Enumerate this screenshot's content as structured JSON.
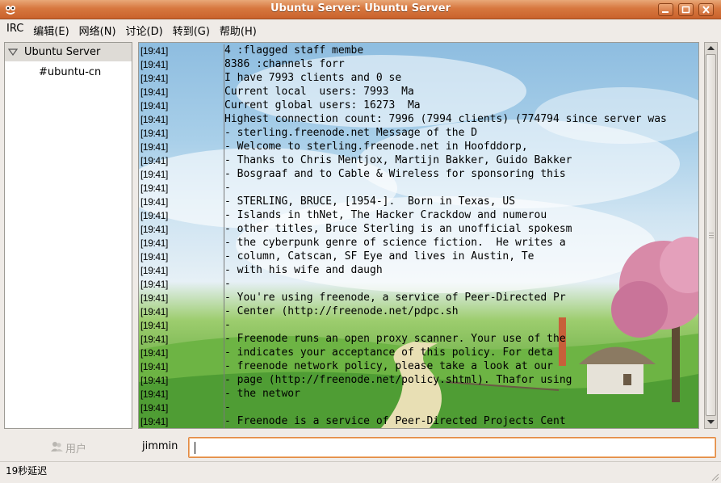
{
  "window": {
    "title": "Ubuntu Server: Ubuntu Server",
    "minimize_icon": "minimize-icon",
    "maximize_icon": "maximize-icon",
    "close_icon": "close-icon"
  },
  "menu": [
    {
      "label": "IRC"
    },
    {
      "label": "编辑(E)"
    },
    {
      "label": "网络(N)"
    },
    {
      "label": "讨论(D)"
    },
    {
      "label": "转到(G)"
    },
    {
      "label": "帮助(H)"
    }
  ],
  "sidebar": {
    "server": "Ubuntu Server",
    "channels": [
      "#ubuntu-cn"
    ]
  },
  "chat": {
    "lines": [
      {
        "ts": "[19:41]",
        "text": "4 :flagged staff membe"
      },
      {
        "ts": "[19:41]",
        "text": "8386 :channels forr"
      },
      {
        "ts": "[19:41]",
        "text": "I have 7993 clients and 0 se"
      },
      {
        "ts": "[19:41]",
        "text": "Current local  users: 7993  Ma"
      },
      {
        "ts": "[19:41]",
        "text": "Current global users: 16273  Ma"
      },
      {
        "ts": "[19:41]",
        "text": "Highest connection count: 7996 (7994 clients) (774794 since server was"
      },
      {
        "ts": "[19:41]",
        "text": "- sterling.freenode.net Message of the D"
      },
      {
        "ts": "[19:41]",
        "text": "- Welcome to sterling.freenode.net in Hoofddorp,"
      },
      {
        "ts": "[19:41]",
        "text": "- Thanks to Chris Mentjox, Martijn Bakker, Guido Bakker"
      },
      {
        "ts": "[19:41]",
        "text": "- Bosgraaf and to Cable & Wireless for sponsoring this"
      },
      {
        "ts": "[19:41]",
        "text": "-"
      },
      {
        "ts": "[19:41]",
        "text": "- STERLING, BRUCE, [1954-].  Born in Texas, US"
      },
      {
        "ts": "[19:41]",
        "text": "- Islands in thNet, The Hacker Crackdow and numerou"
      },
      {
        "ts": "[19:41]",
        "text": "- other titles, Bruce Sterling is an unofficial spokesm"
      },
      {
        "ts": "[19:41]",
        "text": "- the cyberpunk genre of science fiction.  He writes a"
      },
      {
        "ts": "[19:41]",
        "text": "- column, Catscan, SF Eye and lives in Austin, Te"
      },
      {
        "ts": "[19:41]",
        "text": "- with his wife and daugh"
      },
      {
        "ts": "[19:41]",
        "text": "-"
      },
      {
        "ts": "[19:41]",
        "text": "- You're using freenode, a service of Peer-Directed Pr"
      },
      {
        "ts": "[19:41]",
        "text": "- Center (http://freenode.net/pdpc.sh"
      },
      {
        "ts": "[19:41]",
        "text": "-"
      },
      {
        "ts": "[19:41]",
        "text": "- Freenode runs an open proxy scanner. Your use of the"
      },
      {
        "ts": "[19:41]",
        "text": "- indicates your acceptance of this policy. For deta"
      },
      {
        "ts": "[19:41]",
        "text": "- freenode network policy, please take a look at our"
      },
      {
        "ts": "[19:41]",
        "text": "- page (http://freenode.net/policy.shtml). Thafor using"
      },
      {
        "ts": "[19:41]",
        "text": "- the networ"
      },
      {
        "ts": "[19:41]",
        "text": "-"
      },
      {
        "ts": "[19:41]",
        "text": "- Freenode is a service of Peer-Directed Projects Cent"
      }
    ]
  },
  "user_button": {
    "label": "用户",
    "icon": "users-icon"
  },
  "nick": "jimmin",
  "input": {
    "value": "",
    "placeholder": ""
  },
  "status": "19秒延迟",
  "colors": {
    "titlebar": "#d7773f",
    "input_focus": "#e38a43"
  }
}
